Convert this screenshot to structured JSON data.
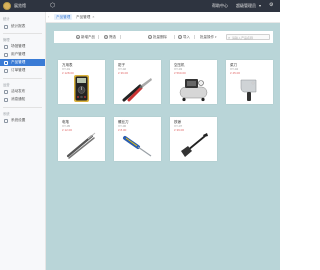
{
  "topbar": {
    "brand": "展览馆",
    "center_link": "帮助中心",
    "user": "超级管理员"
  },
  "sidebar": {
    "sections": [
      {
        "title": "统计",
        "items": [
          {
            "label": "统计报表",
            "active": false
          }
        ]
      },
      {
        "title": "管理",
        "items": [
          {
            "label": "场馆管理",
            "active": false
          },
          {
            "label": "用户管理",
            "active": false
          },
          {
            "label": "产品管理",
            "active": true
          },
          {
            "label": "订单管理",
            "active": false
          }
        ]
      },
      {
        "title": "运营",
        "items": [
          {
            "label": "活动发布",
            "active": false
          },
          {
            "label": "消息通知",
            "active": false
          }
        ]
      },
      {
        "title": "系统",
        "items": [
          {
            "label": "系统设置",
            "active": false
          }
        ]
      }
    ]
  },
  "tabs": [
    {
      "label": "产品管理"
    },
    {
      "label": "产品管理"
    }
  ],
  "toolbar": {
    "buttons": [
      {
        "label": "新增产品",
        "icon": "plus-icon"
      },
      {
        "label": "筛选",
        "icon": "filter-icon"
      },
      {
        "label": "批量删除",
        "icon": "delete-icon"
      },
      {
        "label": "导入",
        "icon": "import-icon"
      },
      {
        "label": "批量操作",
        "icon": "caret-down-icon"
      }
    ],
    "search_placeholder": "请输入产品名称"
  },
  "products": [
    {
      "name": "万用表",
      "sub": "XY-01",
      "price": "¥ 128.00",
      "image": "multimeter"
    },
    {
      "name": "钳子",
      "sub": "XY-02",
      "price": "¥ 36.00",
      "image": "pliers"
    },
    {
      "name": "空压机",
      "sub": "XY-03",
      "price": "¥ 560.00",
      "image": "compressor"
    },
    {
      "name": "菜刀",
      "sub": "XY-04",
      "price": "¥ 45.00",
      "image": "cleaver"
    },
    {
      "name": "电笔",
      "sub": "XY-05",
      "price": "¥ 12.00",
      "image": "test-pencil"
    },
    {
      "name": "螺丝刀",
      "sub": "XY-06",
      "price": "¥ 8.00",
      "image": "screwdriver"
    },
    {
      "name": "铁锹",
      "sub": "XY-07",
      "price": "¥ 39.00",
      "image": "shovel"
    }
  ],
  "colors": {
    "topbar": "#2e3440",
    "accent": "#3a7bd5",
    "main_bg": "#b9d5d8",
    "price": "#e06666"
  }
}
